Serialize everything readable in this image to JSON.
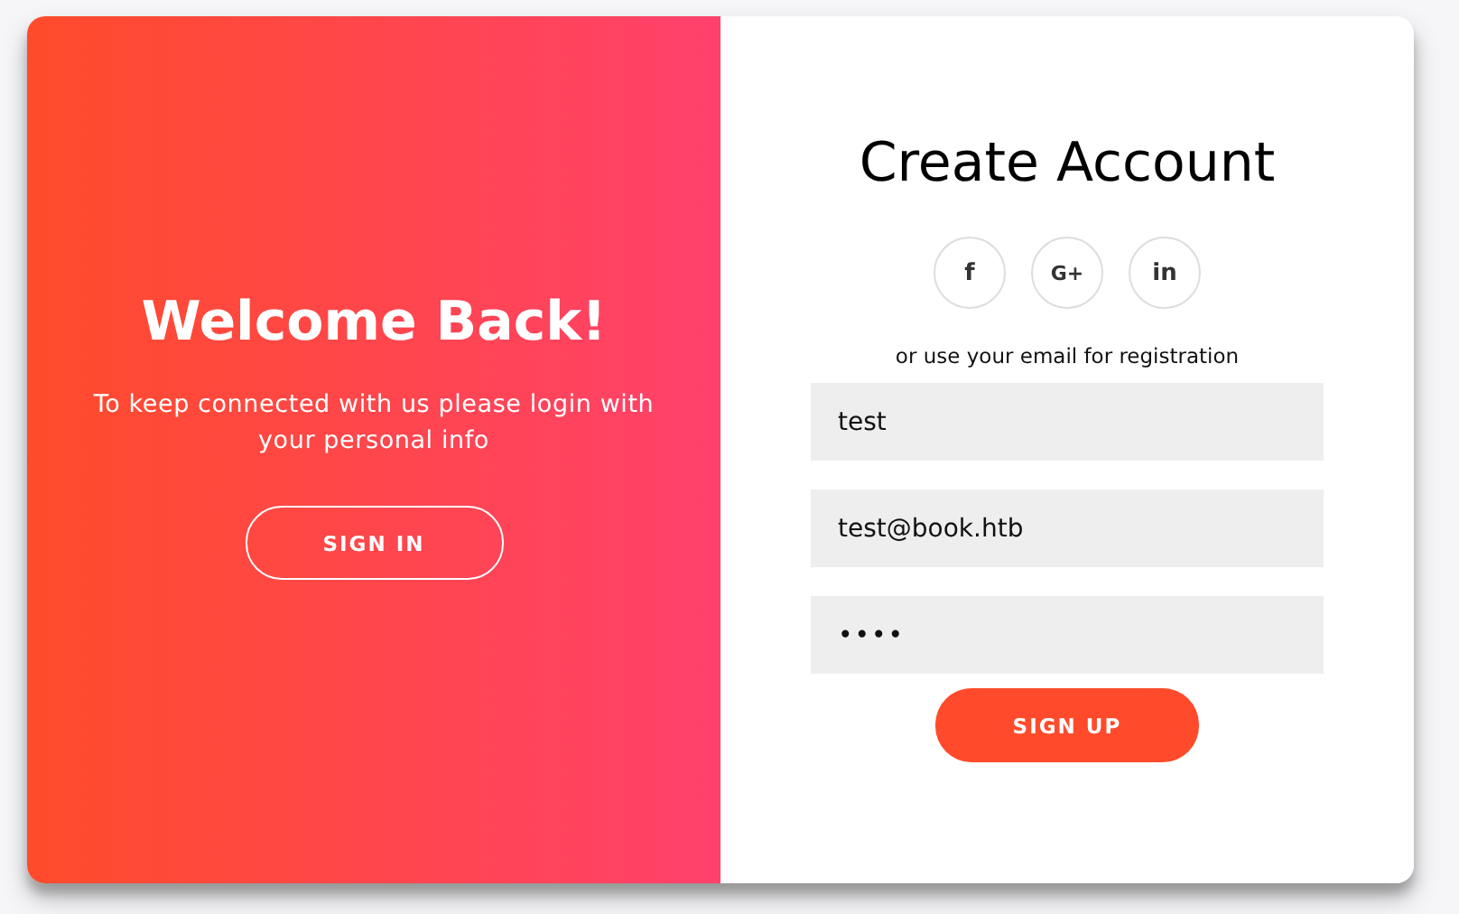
{
  "overlay": {
    "title": "Welcome Back!",
    "text": "To keep connected with us please login with your personal info",
    "button": "SIGN IN"
  },
  "form": {
    "title": "Create Account",
    "social": [
      {
        "kind": "facebook",
        "label": "f"
      },
      {
        "kind": "google",
        "label": "G+"
      },
      {
        "kind": "linkedin",
        "label": "in"
      }
    ],
    "hint": "or use your email for registration",
    "fields": [
      {
        "kind": "text",
        "value": "test"
      },
      {
        "kind": "email",
        "value": "test@book.htb"
      },
      {
        "kind": "password",
        "value": "••••"
      }
    ],
    "button": "SIGN UP"
  }
}
